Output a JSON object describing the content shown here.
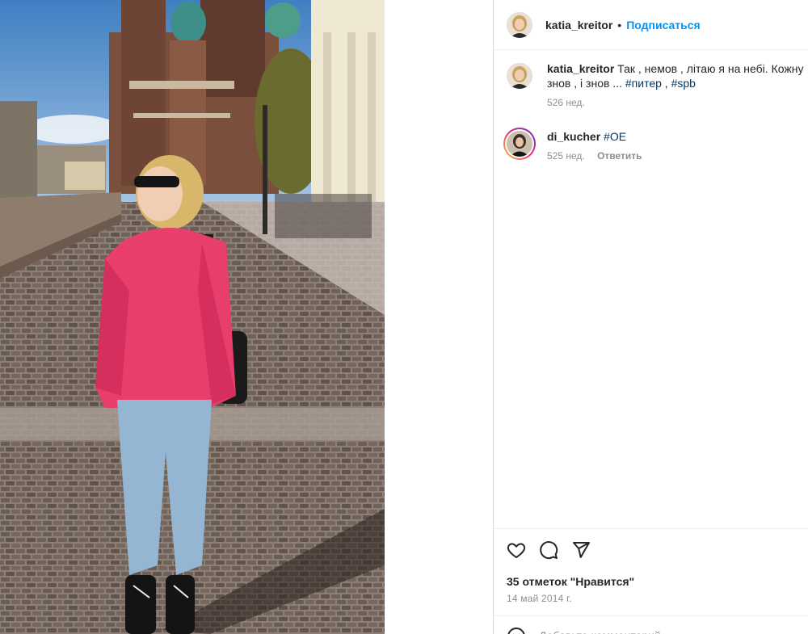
{
  "post": {
    "author": "katia_kreitor",
    "separator": "•",
    "follow_label": "Подписаться"
  },
  "caption": {
    "author": "katia_kreitor",
    "text": "Так , немов , літаю я на небі. Кожну",
    "line2": "знов , і знов ... ",
    "hashtags": [
      "#питер",
      "#spb"
    ],
    "hashtag_sep": " , ",
    "age": "526 нед."
  },
  "comment": {
    "author": "di_kucher",
    "text": "#OE",
    "age": "525 нед.",
    "reply_label": "Ответить"
  },
  "likes": "35 отметок \"Нравится\"",
  "date": "14 май 2014 г.",
  "add_comment": {
    "placeholder": "Добавьте комментарий"
  },
  "icons": {
    "like": "heart-icon",
    "comment": "comment-icon",
    "share": "share-icon",
    "emoji": "emoji-icon"
  },
  "colors": {
    "follow": "#0095f6",
    "hashtag": "#00376b",
    "muted": "#8e8e8e",
    "jacket": "#e83e6c"
  }
}
